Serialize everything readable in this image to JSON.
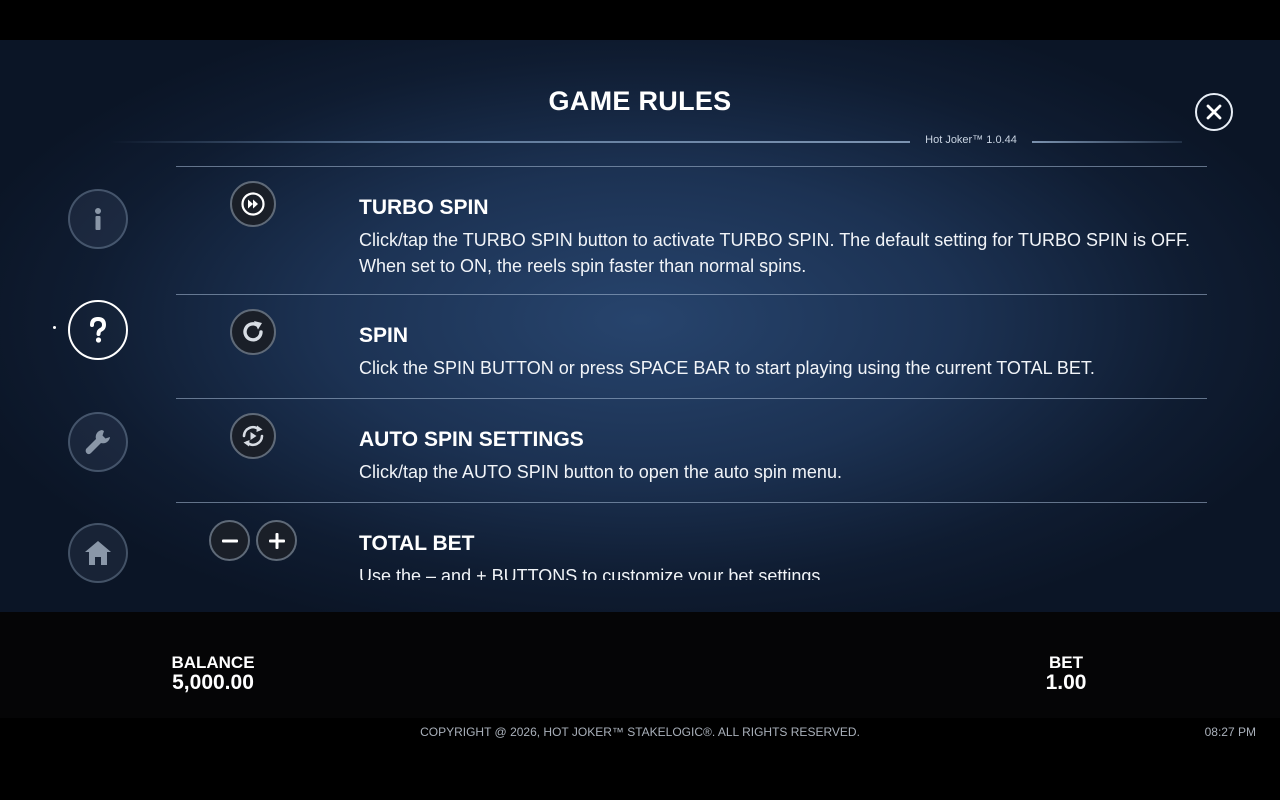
{
  "header": {
    "title": "GAME RULES",
    "version": "Hot Joker™ 1.0.44",
    "close_label": "X"
  },
  "sidebar": {
    "items": [
      {
        "icon": "info-icon",
        "active": false
      },
      {
        "icon": "help-icon",
        "active": true
      },
      {
        "icon": "wrench-icon",
        "active": false
      },
      {
        "icon": "home-icon",
        "active": false
      }
    ]
  },
  "rules": [
    {
      "icon": "turbo-spin-icon",
      "title": "TURBO SPIN",
      "description": "Click/tap the TURBO SPIN button to activate TURBO SPIN. The default setting for TURBO SPIN is OFF. When set to ON, the reels spin faster than normal spins."
    },
    {
      "icon": "spin-icon",
      "title": "SPIN",
      "description": "Click the SPIN BUTTON or press SPACE BAR to start playing using the current TOTAL BET."
    },
    {
      "icon": "auto-spin-icon",
      "title": "AUTO SPIN SETTINGS",
      "description": "Click/tap the AUTO SPIN button to open the auto spin menu."
    },
    {
      "icon": "bet-minus-plus-icons",
      "title": "TOTAL BET",
      "description": "Use the – and + BUTTONS to customize your bet settings."
    }
  ],
  "bottom_bar": {
    "balance_label": "BALANCE",
    "balance_value": "5,000.00",
    "bet_label": "BET",
    "bet_value": "1.00"
  },
  "footer": {
    "copyright": "COPYRIGHT @ 2026, HOT JOKER™ STAKELOGIC®. ALL RIGHTS RESERVED.",
    "time": "08:27 PM"
  },
  "colors": {
    "panel_background": "#1c3253",
    "bar_background": "#050506",
    "text": "#ffffff",
    "muted_text": "#a9b0ba"
  }
}
